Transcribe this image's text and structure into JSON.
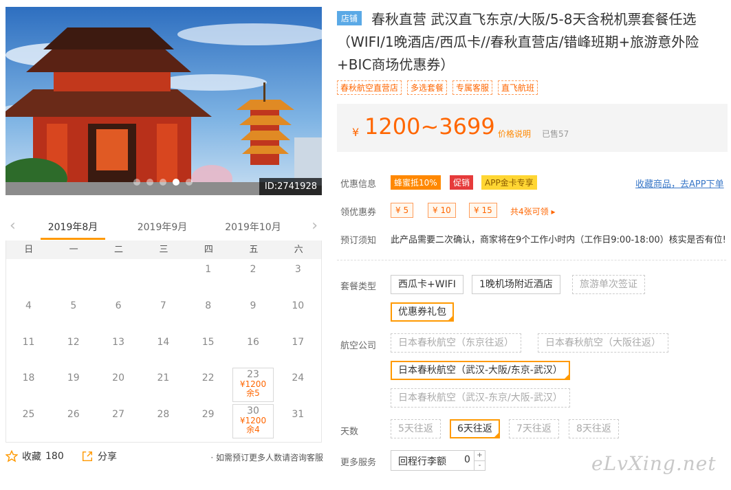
{
  "hero": {
    "id_label": "ID:2741928",
    "dot_count": 5,
    "active_dot": 4
  },
  "calendar": {
    "months": [
      "2019年8月",
      "2019年9月",
      "2019年10月"
    ],
    "active_month": 0,
    "weekdays": [
      "日",
      "一",
      "二",
      "三",
      "四",
      "五",
      "六"
    ],
    "days": [
      [
        "",
        "",
        "",
        "",
        "1",
        "2",
        "3"
      ],
      [
        "4",
        "5",
        "6",
        "7",
        "8",
        "9",
        "10"
      ],
      [
        "11",
        "12",
        "13",
        "14",
        "15",
        "16",
        "17"
      ],
      [
        "18",
        "19",
        "20",
        "21",
        "22",
        "23",
        "24"
      ],
      [
        "25",
        "26",
        "27",
        "28",
        "29",
        "30",
        "31"
      ]
    ],
    "available": [
      {
        "day": "23",
        "price": "¥1200",
        "stock": "余5"
      },
      {
        "day": "30",
        "price": "¥1200",
        "stock": "余4"
      }
    ]
  },
  "actions": {
    "favorite_label": "收藏",
    "favorite_count": "180",
    "share_label": "分享",
    "tip": "· 如需预订更多人数请咨询客服"
  },
  "product": {
    "shop_badge": "店铺",
    "title": "春秋直营 武汉直飞东京/大阪/5-8天含税机票套餐任选（WIFI/1晚酒店/西瓜卡//春秋直营店/错峰班期+旅游意外险+BIC商场优惠券）",
    "tags": [
      "春秋航空直营店",
      "多选套餐",
      "专属客服",
      "直飞航班"
    ],
    "price_currency": "¥",
    "price_range": "1200~3699",
    "price_explain": "价格说明",
    "sold": "已售57"
  },
  "info": {
    "promo_label": "优惠信息",
    "promos": [
      "蜂蜜抵10%",
      "促销",
      "APP金卡专享"
    ],
    "fav_link": "收藏商品，去APP下单",
    "coupon_label": "领优惠券",
    "coupons": [
      "¥ 5",
      "¥ 10",
      "¥ 15"
    ],
    "coupon_more": "共4张可领 ▸",
    "notice_label": "预订须知",
    "notice_text": "此产品需要二次确认，商家将在9个工作小时内（工作日9:00-18:00）核实是否有位!"
  },
  "options": {
    "package_label": "套餐类型",
    "packages": [
      "西瓜卡+WIFI",
      "1晚机场附近酒店",
      "旅游单次签证",
      "优惠券礼包"
    ],
    "airline_label": "航空公司",
    "airlines": [
      "日本春秋航空（东京往返）",
      "日本春秋航空（大阪往返）",
      "日本春秋航空（武汉-大阪/东京-武汉）",
      "日本春秋航空（武汉-东京/大阪-武汉）"
    ],
    "days_label": "天数",
    "days": [
      "5天往返",
      "6天往返",
      "7天往返",
      "8天往返"
    ],
    "more_label": "更多服务",
    "baggage_label": "回程行李额",
    "baggage_value": "0",
    "plus": "+",
    "minus": "-"
  },
  "watermark": "eLvXing.net"
}
